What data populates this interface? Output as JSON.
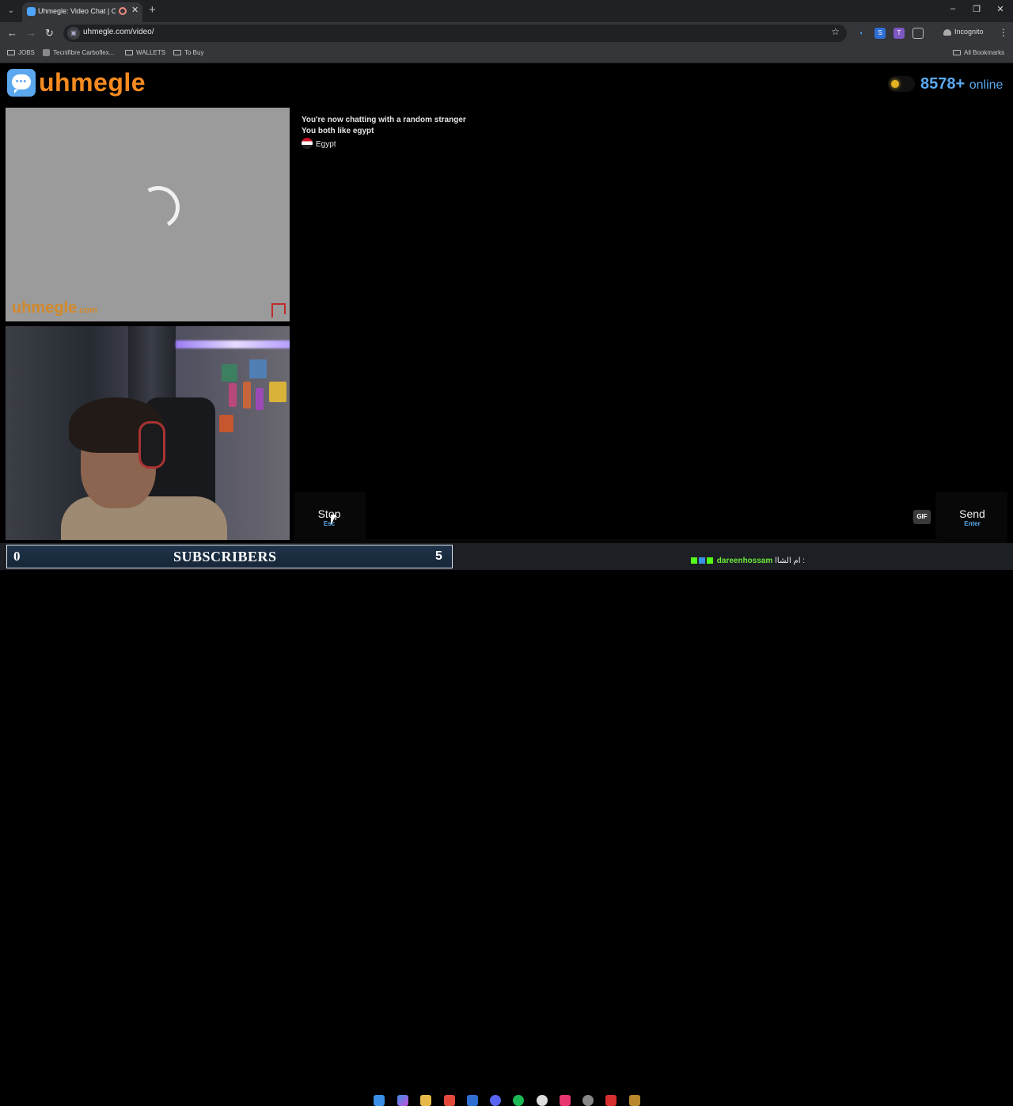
{
  "browser": {
    "tab_title": "Uhmegle: Video Chat | Ome",
    "url": "uhmegle.com/video/",
    "incognito_label": "Incognito",
    "tab_list_glyph": "⌄",
    "tab_close_glyph": "✕",
    "new_tab_glyph": "+",
    "minimize_glyph": "–",
    "restore_glyph": "❐",
    "close_glyph": "✕",
    "back_glyph": "←",
    "forward_glyph": "→",
    "reload_glyph": "↻",
    "star_glyph": "☆",
    "menu_glyph": "⋮",
    "bookmarks": [
      {
        "label": "JOBS"
      },
      {
        "label": "Tecnifibre Carboflex..."
      },
      {
        "label": "WALLETS"
      },
      {
        "label": "To Buy"
      }
    ],
    "all_bookmarks": "All Bookmarks"
  },
  "site": {
    "logo_text": "uhmegle",
    "logo_dots": "•••",
    "online_count": "8578+",
    "online_label": "online",
    "accent": "#5ba8ef",
    "brand": "#f58a1f"
  },
  "stranger_video": {
    "watermark": "uhmegle",
    "watermark_tld": ".com",
    "loading_icon": "spinner-icon",
    "report_icon": "flag-icon"
  },
  "chat": {
    "lines": [
      "You're now chatting with a random stranger",
      "You both like egypt"
    ],
    "country": "Egypt"
  },
  "controls": {
    "stop_label": "Stop",
    "stop_key": "Esc",
    "gif_label": "GIF",
    "send_label": "Send",
    "send_key": "Enter"
  },
  "overlay": {
    "subscriber_count": "0",
    "subscriber_label": "SUBSCRIBERS",
    "taskbar_badge": "5",
    "ticker_user": "dareenhossam",
    "ticker_message": "ام الشاا :"
  }
}
